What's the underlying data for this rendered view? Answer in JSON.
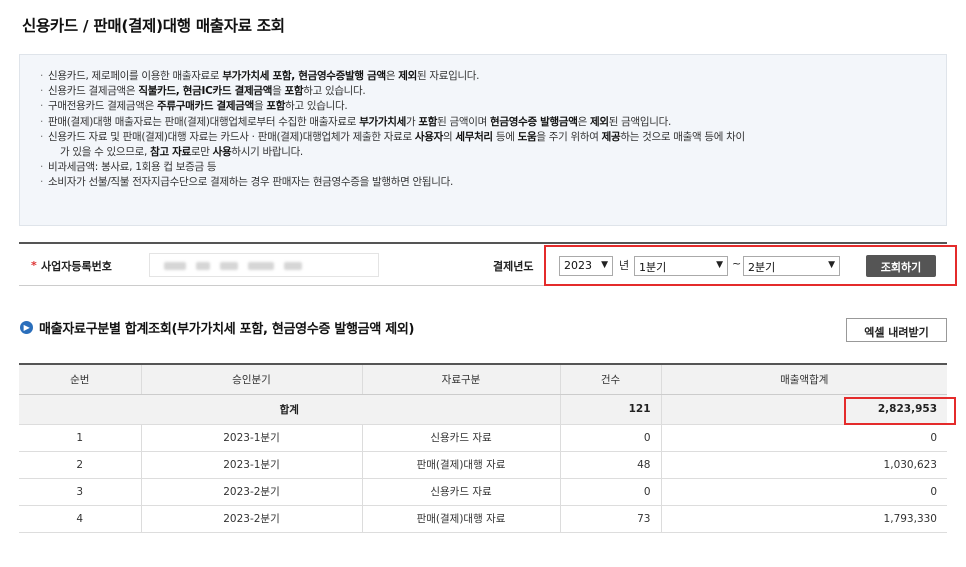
{
  "page_title": "신용카드 / 판매(결제)대행 매출자료 조회",
  "notice": {
    "line1": {
      "p1": "신용카드, 제로페이를 이용한 매출자료로 ",
      "b1": "부가가치세 포함, 현금영수증발행 금액",
      "p2": "은 ",
      "b2": "제외",
      "p3": "된 자료입니다."
    },
    "line2": {
      "p1": "신용카드 결제금액은 ",
      "b1": "직불카드, 현금IC카드 결제금액",
      "p2": "을 ",
      "b2": "포함",
      "p3": "하고 있습니다."
    },
    "line3": {
      "p1": "구매전용카드 결제금액은 ",
      "b1": "주류구매카드 결제금액",
      "p2": "을 ",
      "b2": "포함",
      "p3": "하고 있습니다."
    },
    "line4": {
      "p1": "판매(결제)대행 매출자료는 판매(결제)대행업체로부터 수집한 매출자료로 ",
      "b1": "부가가치세",
      "p2": "가 ",
      "b2": "포함",
      "p3": "된 금액이며 ",
      "b3": "현금영수증 발행금액",
      "p4": "은 ",
      "b4": "제외",
      "p5": "된 금액입니다."
    },
    "line5": {
      "p1": "신용카드 자료 및 판매(결제)대행 자료는 카드사 · 판매(결제)대행업체가 제출한 자료로 ",
      "b1": "사용자",
      "p2": "의 ",
      "b2": "세무처리",
      "p3": " 등에 ",
      "b3": "도움",
      "p4": "을 주기 위하여 ",
      "b4": "제공",
      "p5": "하는 것으로 매출액 등에 차이"
    },
    "line5b": {
      "p1": "가 있을 수 있으므로, ",
      "b1": "참고 자료",
      "p2": "로만 ",
      "b2": "사용",
      "p3": "하시기 바랍니다."
    },
    "line6": "비과세금액: 봉사료, 1회용 컵 보증금 등",
    "line7": "소비자가 선불/직불 전자지급수단으로 결제하는 경우 판매자는 현금영수증을 발행하면 안됩니다."
  },
  "search": {
    "required_mark": "*",
    "biz_label": "사업자등록번호",
    "year_label": "결제년도",
    "year_value": "2023",
    "year_unit": "년",
    "from_quarter": "1분기",
    "tilde": "~",
    "to_quarter": "2분기",
    "search_button": "조회하기"
  },
  "section": {
    "title": "매출자료구분별 합계조회(부가가치세 포함, 현금영수증 발행금액 제외)",
    "excel_button": "엑셀 내려받기"
  },
  "table": {
    "headers": {
      "no": "순번",
      "quarter": "승인분기",
      "type": "자료구분",
      "count": "건수",
      "amount": "매출액합계"
    },
    "total": {
      "label": "합계",
      "count": "121",
      "amount": "2,823,953"
    },
    "rows": [
      {
        "no": "1",
        "quarter": "2023-1분기",
        "type": "신용카드 자료",
        "count": "0",
        "amount": "0"
      },
      {
        "no": "2",
        "quarter": "2023-1분기",
        "type": "판매(결제)대행 자료",
        "count": "48",
        "amount": "1,030,623"
      },
      {
        "no": "3",
        "quarter": "2023-2분기",
        "type": "신용카드 자료",
        "count": "0",
        "amount": "0"
      },
      {
        "no": "4",
        "quarter": "2023-2분기",
        "type": "판매(결제)대행 자료",
        "count": "73",
        "amount": "1,793,330"
      }
    ]
  },
  "colors": {
    "highlight": "#e42b2b",
    "button_dark": "#555555",
    "notice_bg": "#f3f6fa",
    "section_icon": "#2a6ebb"
  }
}
